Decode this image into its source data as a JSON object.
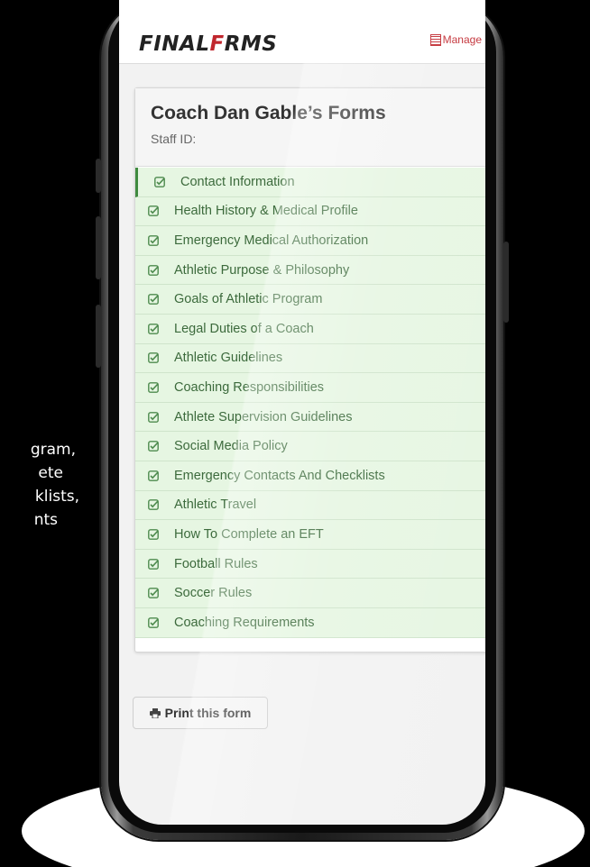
{
  "side_text": {
    "lines": [
      "gram,",
      "ete",
      "klists,",
      "nts"
    ]
  },
  "app": {
    "logo_prefix": "FINAL",
    "logo_accent": "F",
    "logo_suffix": "RMS",
    "manage_label": "Manage"
  },
  "card": {
    "title": "Coach Dan Gable’s Forms",
    "subtitle": "Staff ID:"
  },
  "forms": [
    {
      "label": "Contact Information"
    },
    {
      "label": "Health History & Medical Profile"
    },
    {
      "label": "Emergency Medical Authorization"
    },
    {
      "label": "Athletic Purpose & Philosophy"
    },
    {
      "label": "Goals of Athletic Program"
    },
    {
      "label": "Legal Duties of a Coach"
    },
    {
      "label": "Athletic Guidelines"
    },
    {
      "label": "Coaching Responsibilities"
    },
    {
      "label": "Athlete Supervision Guidelines"
    },
    {
      "label": "Social Media Policy"
    },
    {
      "label": "Emergency Contacts And Checklists"
    },
    {
      "label": "Athletic Travel"
    },
    {
      "label": "How To Complete an EFT"
    },
    {
      "label": "Football Rules"
    },
    {
      "label": "Soccer Rules"
    },
    {
      "label": "Coaching Requirements"
    }
  ],
  "print_button": {
    "label": "Print this form"
  },
  "colors": {
    "brand_red": "#c0262d",
    "complete_green_bg": "#e6f6e2",
    "complete_green_text": "#3c6a3c"
  }
}
